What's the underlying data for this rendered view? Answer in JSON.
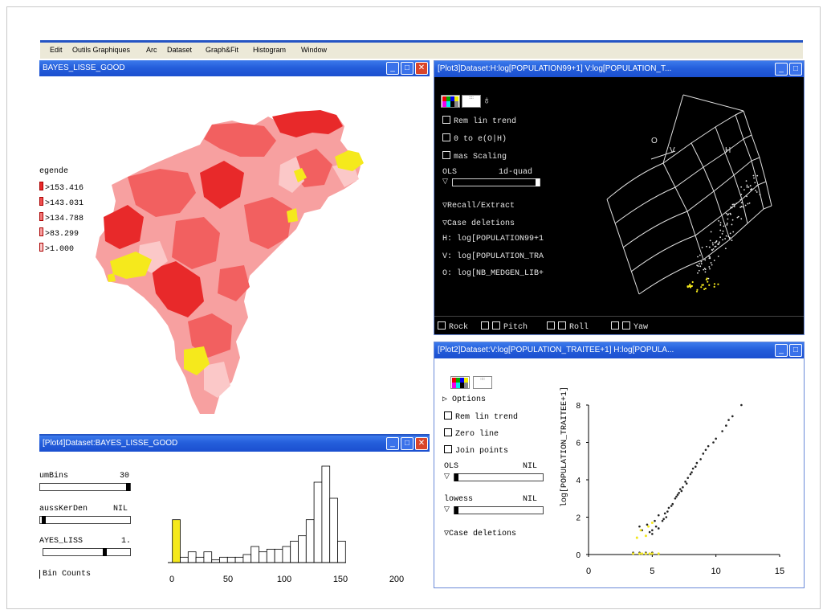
{
  "menu": [
    "Edit",
    "Outils Graphiques",
    "Arc",
    "Dataset",
    "Graph&Fit",
    "Histogram",
    "Window"
  ],
  "colors": {
    "map_dark": "#e8292a",
    "map_mid": "#f26060",
    "map_light": "#f7a0a0",
    "map_pale": "#fbc8c8",
    "highlight": "#f5e91c",
    "titlebar": "#245edb",
    "plot_bg": "#000000"
  },
  "map_window": {
    "title": "BAYES_LISSE_GOOD",
    "legend_title": "egende",
    "legend": [
      ">153.416",
      ">143.031",
      ">134.788",
      ">83.299",
      ">1.000"
    ]
  },
  "plot3_window": {
    "title": "[Plot3]Dataset:H:log[POPULATION99+1] V:log[POPULATION_T...",
    "controls": {
      "rem_lin_trend": "Rem lin trend",
      "zero_to_e": "0 to e(O|H)",
      "mas_scaling": "mas Scaling",
      "ols": "OLS",
      "quad": "1d-quad",
      "recall": "Recall/Extract",
      "case_deletions": "Case deletions",
      "h_axis": "H: log[POPULATION99+1",
      "v_axis": "V: log[POPULATION_TRA",
      "o_axis": "O: log[NB_MEDGEN_LIB+"
    },
    "surface_labels": [
      "O",
      "V",
      "H"
    ],
    "bottom_bar": {
      "rock": "Rock",
      "pitch": "Pitch",
      "roll": "Roll",
      "yaw": "Yaw"
    }
  },
  "plot2_window": {
    "title": "[Plot2]Dataset:V:log[POPULATION_TRAITEE+1] H:log[POPULA...",
    "controls": {
      "options": "Options",
      "rem_lin_trend": "Rem lin trend",
      "zero_line": "Zero line",
      "join_points": "Join points",
      "ols": "OLS",
      "ols_value": "NIL",
      "lowess": "lowess",
      "lowess_value": "NIL",
      "case_deletions": "Case deletions"
    }
  },
  "plot4_window": {
    "title": "[Plot4]Dataset:BAYES_LISSE_GOOD",
    "controls": {
      "numbins": "umBins",
      "numbins_value": "30",
      "gauss": "aussKerDen",
      "gauss_value": "NIL",
      "bayes": "AYES_LISS",
      "bayes_value": "1.",
      "bin_counts": "Bin Counts"
    }
  },
  "chart_data": [
    {
      "type": "bar",
      "name": "histogram",
      "x": [
        4,
        11,
        18,
        25,
        32,
        39,
        46,
        53,
        60,
        67,
        74,
        81,
        88,
        95,
        102,
        109,
        116,
        123,
        130,
        137,
        144,
        151
      ],
      "values": [
        8,
        1,
        2,
        1,
        2,
        0.5,
        1,
        1,
        1,
        1.5,
        3,
        2,
        2.5,
        2.5,
        3,
        4,
        5,
        8,
        15,
        18,
        12,
        4
      ],
      "highlight_index": 0,
      "xlim": [
        0,
        200
      ],
      "x_ticks": [
        0,
        50,
        100,
        150,
        200
      ]
    },
    {
      "type": "scatter",
      "name": "plot2",
      "ylabel": "log[POPULATION_TRAITEE+1]",
      "xlim": [
        0,
        15
      ],
      "ylim": [
        0,
        8
      ],
      "x_ticks": [
        0,
        5,
        10,
        15
      ],
      "y_ticks": [
        0,
        2,
        4,
        6,
        8
      ],
      "points": [
        [
          3.5,
          0.1
        ],
        [
          4,
          0.1
        ],
        [
          4.5,
          0.1
        ],
        [
          5,
          0.1
        ],
        [
          3.8,
          0.9
        ],
        [
          4.5,
          1.0
        ],
        [
          5,
          1.1
        ],
        [
          4.2,
          1.3
        ],
        [
          5,
          1.3
        ],
        [
          5.5,
          1.4
        ],
        [
          4.6,
          1.6
        ],
        [
          5.2,
          1.8
        ],
        [
          5.8,
          1.8
        ],
        [
          4,
          1.5
        ],
        [
          5.5,
          2.1
        ],
        [
          6,
          2.2
        ],
        [
          6.3,
          2.5
        ],
        [
          6.6,
          2.7
        ],
        [
          6.8,
          3.0
        ],
        [
          7,
          3.2
        ],
        [
          7.2,
          3.5
        ],
        [
          7.4,
          3.6
        ],
        [
          7.6,
          3.9
        ],
        [
          7.8,
          4.1
        ],
        [
          8,
          4.3
        ],
        [
          8.2,
          4.6
        ],
        [
          8.5,
          4.9
        ],
        [
          8.8,
          5.1
        ],
        [
          9,
          5.4
        ],
        [
          9.4,
          5.8
        ],
        [
          9.8,
          6.0
        ],
        [
          10,
          6.2
        ],
        [
          10.5,
          6.6
        ],
        [
          11,
          7.2
        ],
        [
          12,
          8.0
        ],
        [
          6.5,
          2.6
        ],
        [
          7.1,
          3.3
        ],
        [
          7.7,
          3.8
        ],
        [
          6.2,
          2.3
        ],
        [
          5.9,
          1.9
        ],
        [
          6.9,
          3.1
        ],
        [
          8.4,
          4.7
        ],
        [
          9.2,
          5.6
        ],
        [
          11.3,
          7.4
        ],
        [
          10.8,
          6.9
        ],
        [
          5.3,
          1.5
        ],
        [
          4.8,
          1.2
        ],
        [
          6.1,
          2.0
        ],
        [
          7.3,
          3.4
        ],
        [
          8.1,
          4.4
        ]
      ],
      "highlight_points": [
        [
          3.5,
          0.05
        ],
        [
          4,
          0.05
        ],
        [
          4.5,
          0.05
        ],
        [
          5,
          0.05
        ],
        [
          4.2,
          0.05
        ],
        [
          4.8,
          0.05
        ],
        [
          5.5,
          0.05
        ],
        [
          3.8,
          0.9
        ],
        [
          4.1,
          1.3
        ],
        [
          4.5,
          1.0
        ],
        [
          4.7,
          1.5
        ],
        [
          5.0,
          1.7
        ]
      ]
    }
  ]
}
